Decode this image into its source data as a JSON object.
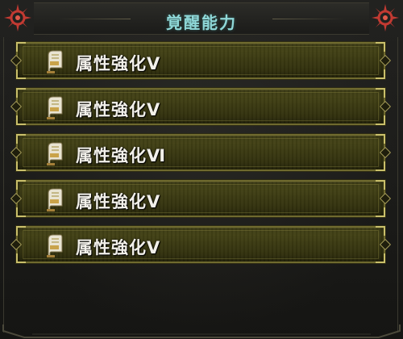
{
  "header": {
    "title": "覚醒能力",
    "left_emblem_icon": "sun-emblem-icon",
    "right_emblem_icon": "sun-emblem-icon"
  },
  "skills": [
    {
      "label": "属性強化Ⅴ",
      "icon": "scroll-icon"
    },
    {
      "label": "属性強化Ⅴ",
      "icon": "scroll-icon"
    },
    {
      "label": "属性強化Ⅵ",
      "icon": "scroll-icon"
    },
    {
      "label": "属性強化Ⅴ",
      "icon": "scroll-icon"
    },
    {
      "label": "属性強化Ⅴ",
      "icon": "scroll-icon"
    }
  ],
  "colors": {
    "title_text": "#8fd8d8",
    "row_fill": "#3b3a12",
    "row_border": "#6f6a2e",
    "emblem": "#c23a32",
    "label_text": "#f2f0ea"
  }
}
